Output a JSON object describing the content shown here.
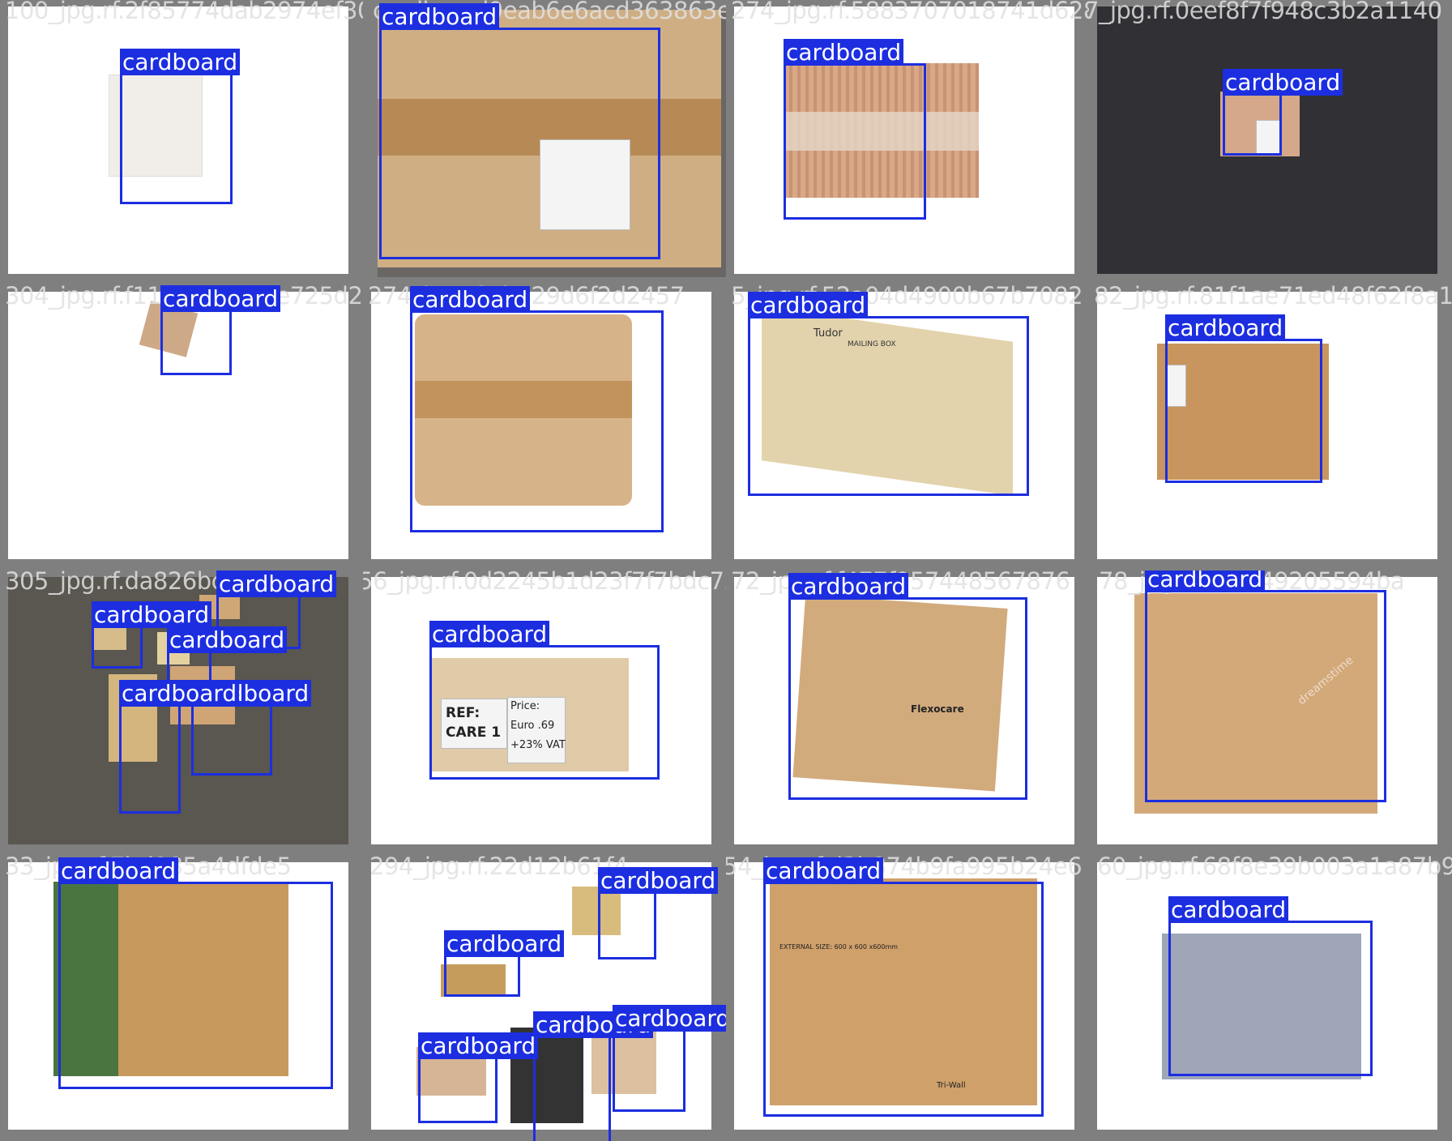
{
  "tiles": [
    {
      "filename": "100_jpg.rf.2f85774dab2974ef303",
      "labels": [
        "cardboard"
      ]
    },
    {
      "filename": "cardboard9eab6e6acd363863e54",
      "labels": [
        "cardboard"
      ]
    },
    {
      "filename": "274_jpg.rf.5883707018741d628b47",
      "labels": [
        "cardboard"
      ]
    },
    {
      "filename": "7_jpg.rf.0eef8f7f948c3b2a1140",
      "labels": [
        "cardboard"
      ]
    },
    {
      "filename": "304_jpg.rf.f115c15820de725d274",
      "labels": [
        "cardboard"
      ]
    },
    {
      "filename": "274_jpg.rf.3b929d6f2d2457",
      "labels": [
        "cardboard"
      ]
    },
    {
      "filename": "5_jpg.rf.52a04d4900b67b7082",
      "labels": [
        "cardboard"
      ]
    },
    {
      "filename": "82_jpg.rf.81f1ae71ed48f62f8a1",
      "labels": [
        "cardboard"
      ]
    },
    {
      "filename": "305_jpg.rf.da826bc7f744715",
      "labels": [
        "cardboard",
        "cardboard",
        "cardboard",
        "cardboard",
        "cardboard"
      ]
    },
    {
      "filename": "56_jpg.rf.0d2245b1d23f7f7bdc72",
      "labels": [
        "cardboard"
      ]
    },
    {
      "filename": "72_jpg.rf.f477f957448567876",
      "labels": [
        "cardboard"
      ]
    },
    {
      "filename": "78_jpg.rf.c44a49205594ba",
      "labels": [
        "cardboard"
      ]
    },
    {
      "filename": "33_jpg.rf.7bd985a4dfde5",
      "labels": [
        "cardboard"
      ]
    },
    {
      "filename": "294_jpg.rf.22d12b61f4",
      "labels": [
        "cardboard",
        "cardboard",
        "cardboard",
        "cardboard",
        "cardboard"
      ]
    },
    {
      "filename": "54_jpg.rf.d3b874b9fa995b24e6",
      "labels": [
        "cardboard"
      ]
    },
    {
      "filename": "60_jpg.rf.68f8e39b003a1a87b94",
      "labels": [
        "cardboard"
      ]
    }
  ],
  "box_texts": {
    "ref": "REF:",
    "care": "CARE 1",
    "price": "Price:",
    "euro": "Euro .69",
    "vat": "+23% VAT",
    "tudor": "Tudor",
    "mailing": "MAILING BOX",
    "flexocare": "Flexocare",
    "external": "EXTERNAL SIZE: 600 x 600 x600mm",
    "triwall": "Tri-Wall",
    "dreamstime": "dreamstime"
  },
  "colors": {
    "box_border": "#1c2ee0",
    "label_bg": "#1c2ee0",
    "label_text": "#ffffff",
    "grid_bg": "#808080"
  }
}
